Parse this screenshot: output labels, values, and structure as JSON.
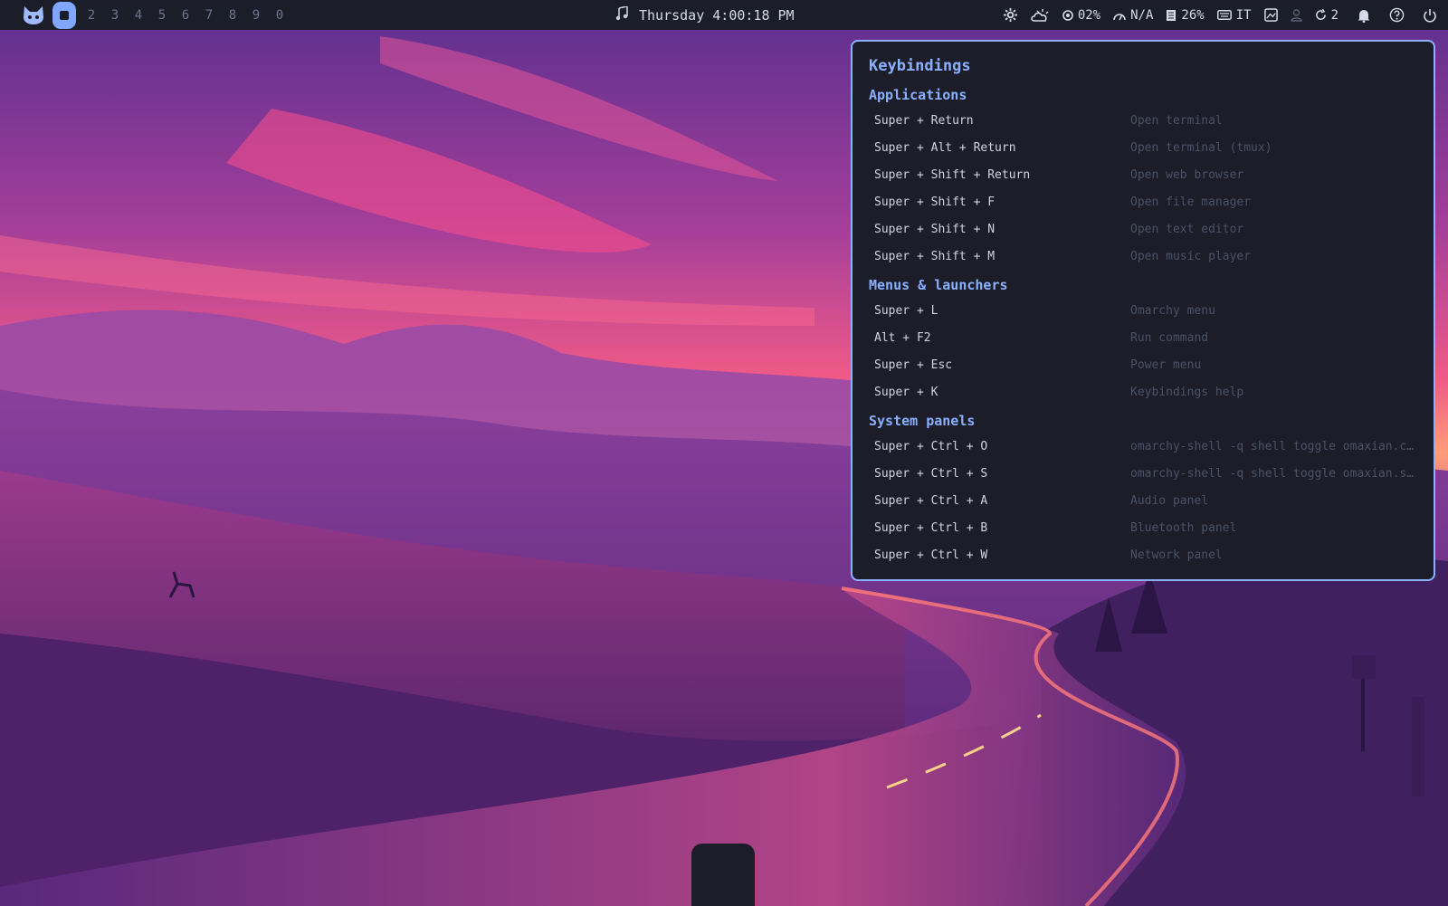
{
  "topbar": {
    "workspaces": [
      "2",
      "3",
      "4",
      "5",
      "6",
      "7",
      "8",
      "9",
      "0"
    ],
    "clock": "Thursday 4:00:18 PM",
    "cpu": "02%",
    "speed": "N/A",
    "memory": "26%",
    "keyboard_layout": "IT",
    "updates": "2"
  },
  "keybindings": {
    "title": "Keybindings",
    "sections": [
      {
        "heading": "Applications",
        "rows": [
          {
            "key": "Super + Return",
            "desc": "Open terminal"
          },
          {
            "key": "Super + Alt + Return",
            "desc": "Open terminal (tmux)"
          },
          {
            "key": "Super + Shift + Return",
            "desc": "Open web browser"
          },
          {
            "key": "Super + Shift + F",
            "desc": "Open file manager"
          },
          {
            "key": "Super + Shift + N",
            "desc": "Open text editor"
          },
          {
            "key": "Super + Shift + M",
            "desc": "Open music player"
          }
        ]
      },
      {
        "heading": "Menus & launchers",
        "rows": [
          {
            "key": "Super + L",
            "desc": "Omarchy menu"
          },
          {
            "key": "Alt + F2",
            "desc": "Run command"
          },
          {
            "key": "Super + Esc",
            "desc": "Power menu"
          },
          {
            "key": "Super + K",
            "desc": "Keybindings help"
          }
        ]
      },
      {
        "heading": "System panels",
        "rows": [
          {
            "key": "Super + Ctrl + O",
            "desc": "omarchy-shell -q shell toggle omaxian.cont…"
          },
          {
            "key": "Super + Ctrl + S",
            "desc": "omarchy-shell -q shell toggle omaxian.sett…"
          },
          {
            "key": "Super + Ctrl + A",
            "desc": "Audio panel"
          },
          {
            "key": "Super + Ctrl + B",
            "desc": "Bluetooth panel"
          },
          {
            "key": "Super + Ctrl + W",
            "desc": "Network panel"
          }
        ]
      }
    ]
  },
  "colors": {
    "accent": "#8ab1ff",
    "bar_bg": "#1b1d29",
    "panel_bg": "#1c1d28"
  },
  "icons": {
    "logo": "cat-icon",
    "clock": "music-note-icon",
    "tray": [
      "gear-icon",
      "weather-icon",
      "cpu-icon",
      "speedometer-icon",
      "memory-icon",
      "keyboard-icon",
      "screenshot-icon",
      "user-icon",
      "update-icon",
      "bell-icon",
      "help-icon",
      "power-icon"
    ]
  }
}
